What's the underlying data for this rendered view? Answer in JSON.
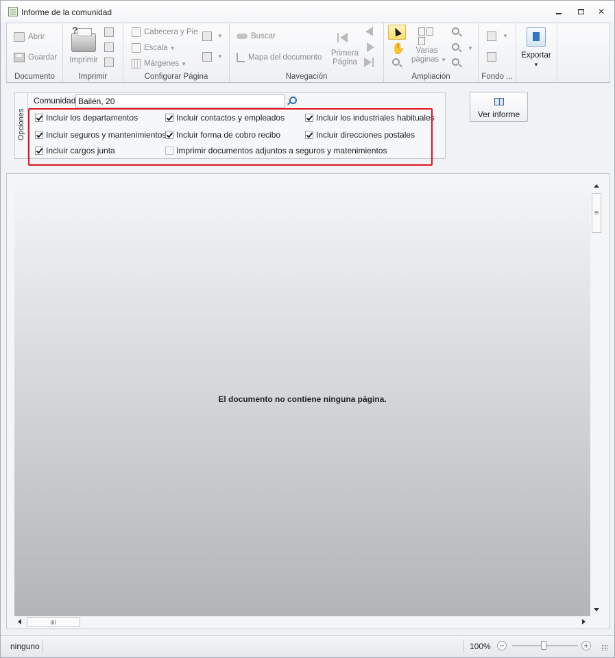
{
  "window": {
    "title": "Informe de la comunidad",
    "minimize": "–",
    "restore": "□",
    "close": "✕"
  },
  "ribbon": {
    "documento": {
      "label": "Documento",
      "abrir": "Abrir",
      "guardar": "Guardar"
    },
    "imprimir": {
      "label": "Imprimir",
      "imprimir": "Imprimir"
    },
    "configurar": {
      "label": "Configurar Página",
      "cabecera": "Cabecera y Pie",
      "escala": "Escala",
      "margenes": "Márgenes"
    },
    "navegacion": {
      "label": "Navegación",
      "buscar": "Buscar",
      "mapa": "Mapa del documento",
      "primera_line1": "Primera",
      "primera_line2": "Página"
    },
    "ampliacion": {
      "label": "Ampliación",
      "varias_line1": "Varias",
      "varias_line2": "páginas"
    },
    "fondo": {
      "label": "Fondo ..."
    },
    "exportar": {
      "label": "Exportar"
    }
  },
  "options": {
    "tab_label": "Opciones",
    "comunidad_label": "Comunidad:",
    "comunidad_value": "Bailén, 20",
    "checkboxes": [
      {
        "label": "Incluir los departamentos",
        "checked": true
      },
      {
        "label": "Incluir contactos y empleados",
        "checked": true
      },
      {
        "label": "Incluir los industriales habituales",
        "checked": true
      },
      {
        "label": "Incluir seguros y mantenimientos",
        "checked": true
      },
      {
        "label": "Incluir forma de cobro recibo",
        "checked": true
      },
      {
        "label": "Incluir direcciones postales",
        "checked": true
      },
      {
        "label": "Incluir cargos junta",
        "checked": true
      },
      {
        "label": "Imprimir documentos adjuntos a seguros y matenimientos",
        "checked": false
      }
    ],
    "ver_informe": "Ver informe"
  },
  "viewer": {
    "empty_message": "El documento no contiene ninguna página."
  },
  "status": {
    "left_text": "ninguno",
    "zoom": "100%",
    "zoom_out": "−",
    "zoom_in": "+"
  },
  "colors": {
    "highlight_border": "#e0141f",
    "active_tool": "#ffdd6e"
  }
}
